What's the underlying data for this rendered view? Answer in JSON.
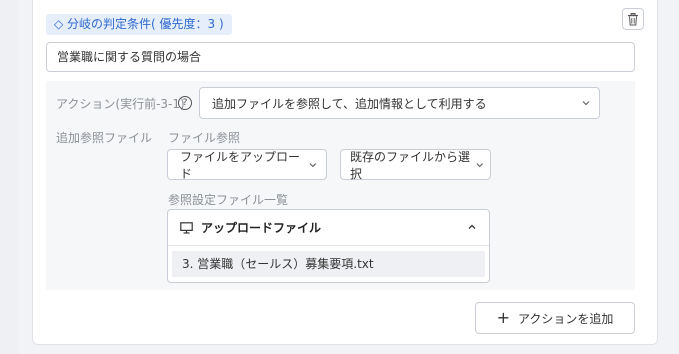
{
  "condition": {
    "tag_label": "◇ 分岐の判定条件( 優先度：3 )",
    "input_value": "営業職に関する質問の場合"
  },
  "action": {
    "label": "アクション(実行前-3-1)",
    "help_icon": "?",
    "selected": "追加ファイルを参照して、追加情報として利用する"
  },
  "additional_files": {
    "label": "追加参照ファイル",
    "file_ref_label": "ファイル参照",
    "upload_dropdown": "ファイルをアップロード",
    "existing_dropdown": "既存のファイルから選択",
    "list_label": "参照設定ファイル一覧",
    "panel_title": "アップロードファイル",
    "files": [
      "3. 営業職（セールス）募集要項.txt"
    ]
  },
  "add_action_button": "アクションを追加",
  "icons": {
    "trash": "trash-icon",
    "monitor": "monitor-icon",
    "chevron_down": "chevron-down-icon",
    "chevron_up": "chevron-up-icon",
    "plus": "plus-icon"
  },
  "colors": {
    "tag_bg": "#e6eefb",
    "tag_text": "#2f6ad0",
    "panel_bg": "#f6f7f9"
  }
}
